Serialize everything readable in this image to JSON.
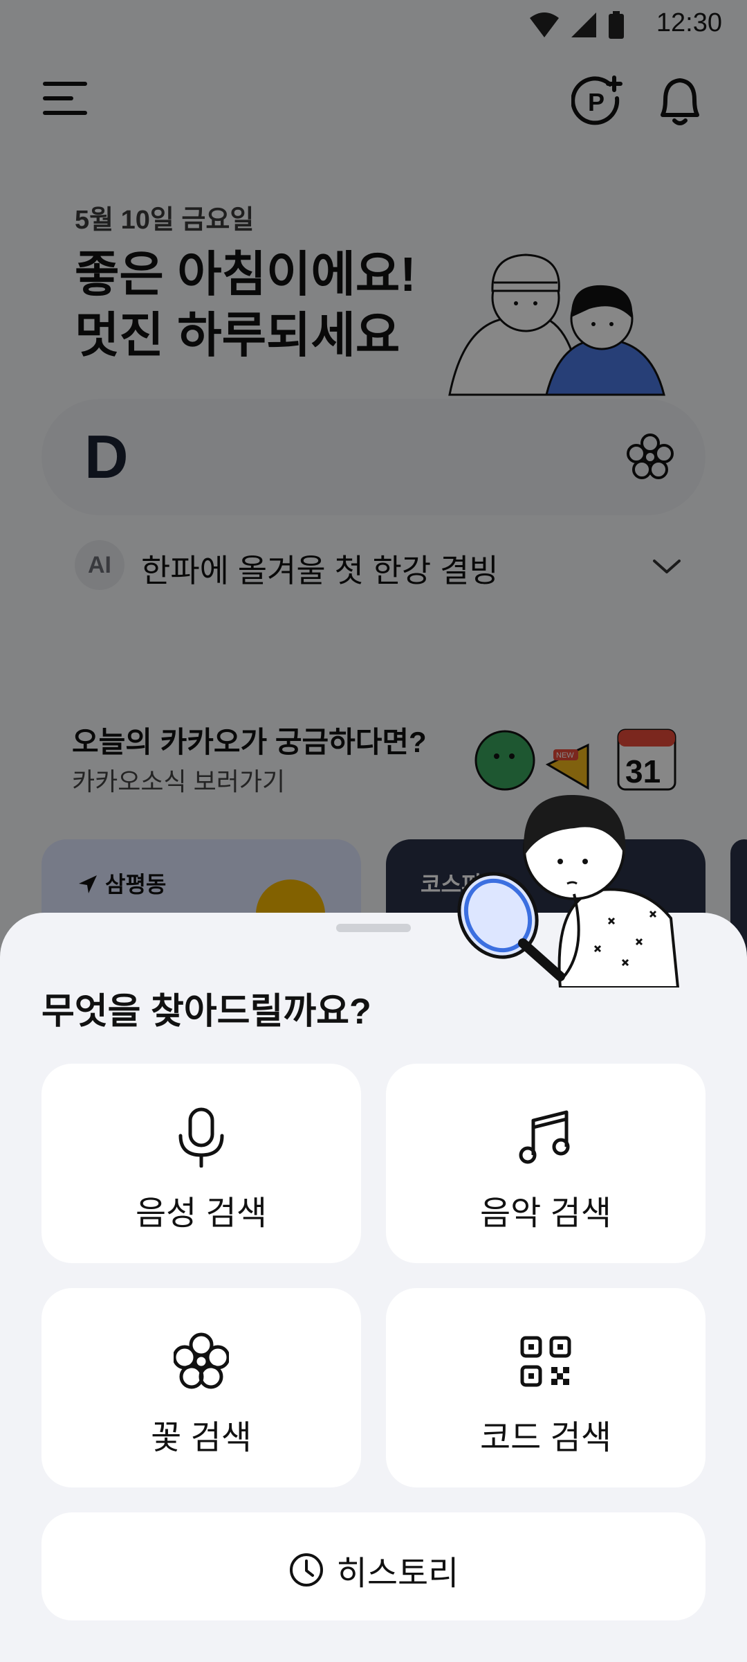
{
  "status_bar": {
    "time": "12:30"
  },
  "header": {
    "date": "5월 10일 금요일",
    "greeting_line1": "좋은 아침이에요!",
    "greeting_line2": "멋진 하루되세요"
  },
  "search": {
    "logo": "D"
  },
  "ai_suggestion": {
    "badge": "AI",
    "text": "한파에 올겨울 첫 한강 결빙"
  },
  "promo": {
    "title": "오늘의 카카오가 궁금하다면?",
    "subtitle": "카카오소식 보러가기",
    "calendar_day": "31",
    "new_tag": "NEW"
  },
  "cards": [
    {
      "label": "삼평동"
    },
    {
      "label": "코스피"
    }
  ],
  "sheet": {
    "title": "무엇을 찾아드릴까요?",
    "options": [
      {
        "label": "음성 검색",
        "icon": "microphone-icon"
      },
      {
        "label": "음악 검색",
        "icon": "music-note-icon"
      },
      {
        "label": "꽃 검색",
        "icon": "flower-icon"
      },
      {
        "label": "코드 검색",
        "icon": "qr-code-icon"
      }
    ],
    "history_label": "히스토리"
  },
  "colors": {
    "accent": "#1b2333",
    "sheet_bg": "#f2f3f7",
    "dim_overlay": "rgba(0,0,0,0.47)"
  }
}
